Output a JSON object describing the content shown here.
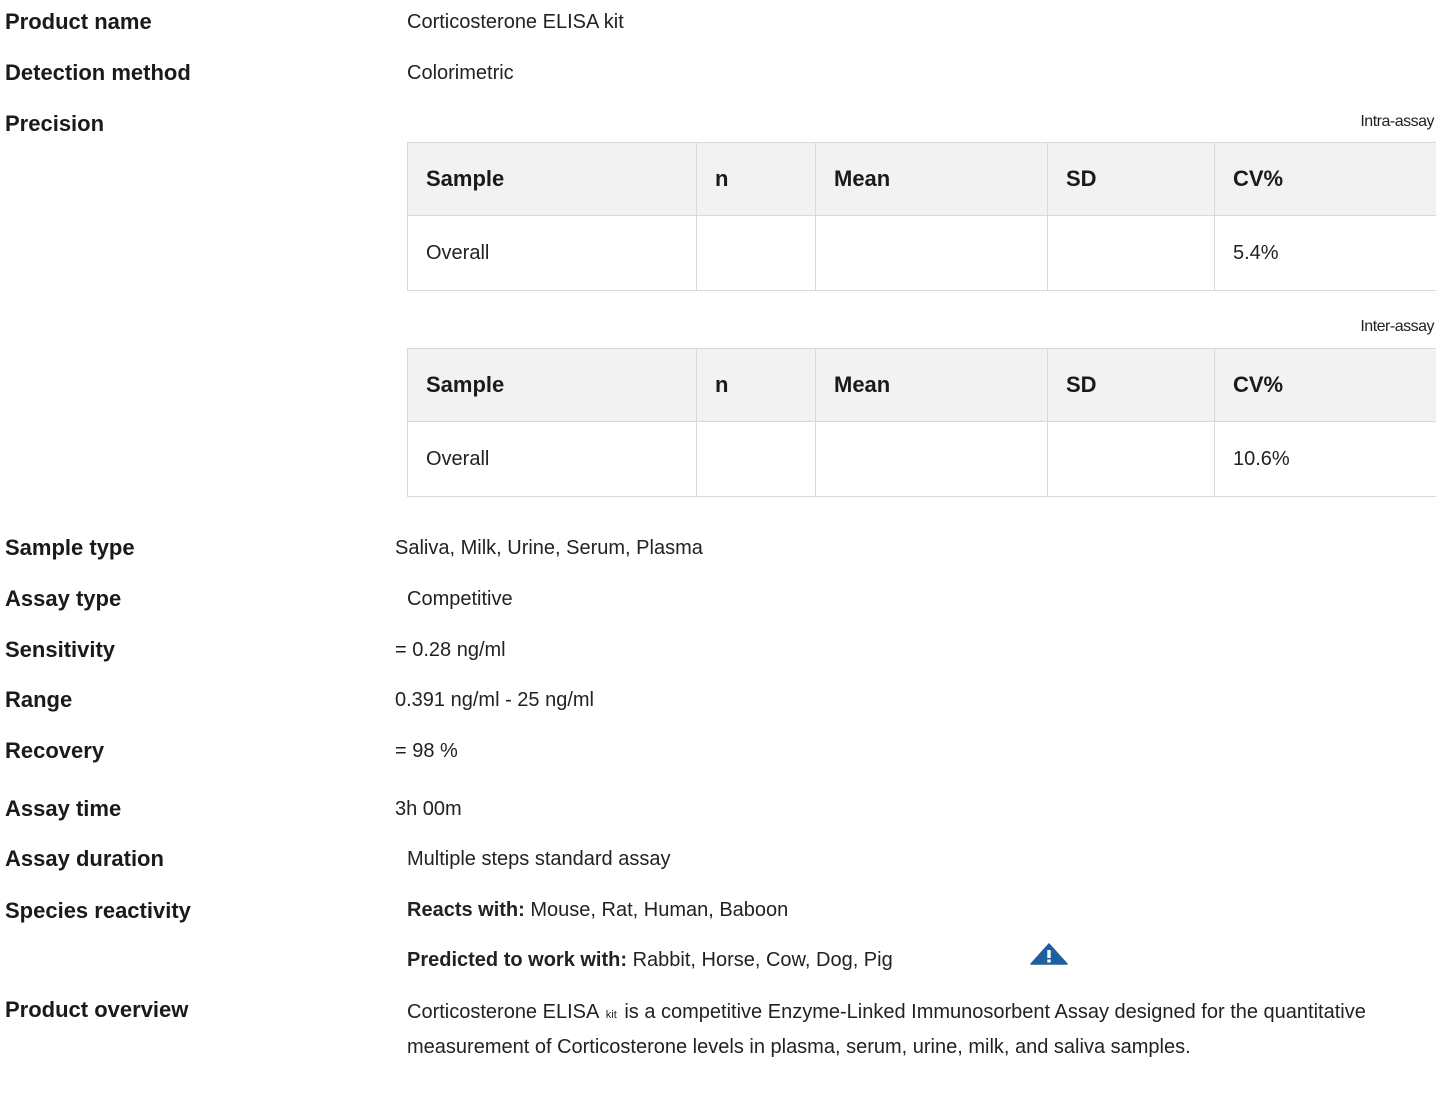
{
  "rows": {
    "product_name": {
      "label": "Product name",
      "value": "Corticosterone ELISA kit"
    },
    "detection_method": {
      "label": "Detection method",
      "value": "Colorimetric"
    },
    "precision": {
      "label": "Precision"
    },
    "sample_type": {
      "label": "Sample type",
      "value": "Saliva, Milk, Urine, Serum, Plasma"
    },
    "assay_type": {
      "label": "Assay type",
      "value": "Competitive"
    },
    "sensitivity": {
      "label": "Sensitivity",
      "value": "= 0.28 ng/ml"
    },
    "range": {
      "label": "Range",
      "value": "0.391 ng/ml - 25 ng/ml"
    },
    "recovery": {
      "label": "Recovery",
      "value": "= 98 %"
    },
    "assay_time": {
      "label": "Assay time",
      "value": "3h 00m"
    },
    "assay_duration": {
      "label": "Assay duration",
      "value": "Multiple steps standard assay"
    },
    "species_reactivity": {
      "label": "Species reactivity",
      "reacts_label": "Reacts with:",
      "reacts_value": "Mouse, Rat, Human, Baboon",
      "predicted_label": "Predicted to work with:",
      "predicted_value": "Rabbit, Horse, Cow, Dog, Pig"
    },
    "product_overview": {
      "label": "Product overview",
      "text_start": "Corticosterone ELISA",
      "text_small": "kit",
      "text_end": "is a competitive Enzyme-Linked Immunosorbent Assay designed for the quantitative measurement of Corticosterone levels in plasma, serum, urine, milk, and saliva samples."
    }
  },
  "precision_tables": {
    "columns": [
      "Sample",
      "n",
      "Mean",
      "SD",
      "CV%"
    ],
    "intra": {
      "caption": "Intra-assay",
      "row": [
        "Overall",
        "",
        "",
        "",
        "5.4%"
      ]
    },
    "inter": {
      "caption": "Inter-assay",
      "row": [
        "Overall",
        "",
        "",
        "",
        "10.6%"
      ]
    }
  },
  "colors": {
    "warning_icon": "#1f5f9e",
    "header_bg": "#f2f2f2",
    "border": "#d9d9d9"
  },
  "icons": {
    "predicted_warning": "warning-triangle-icon"
  }
}
